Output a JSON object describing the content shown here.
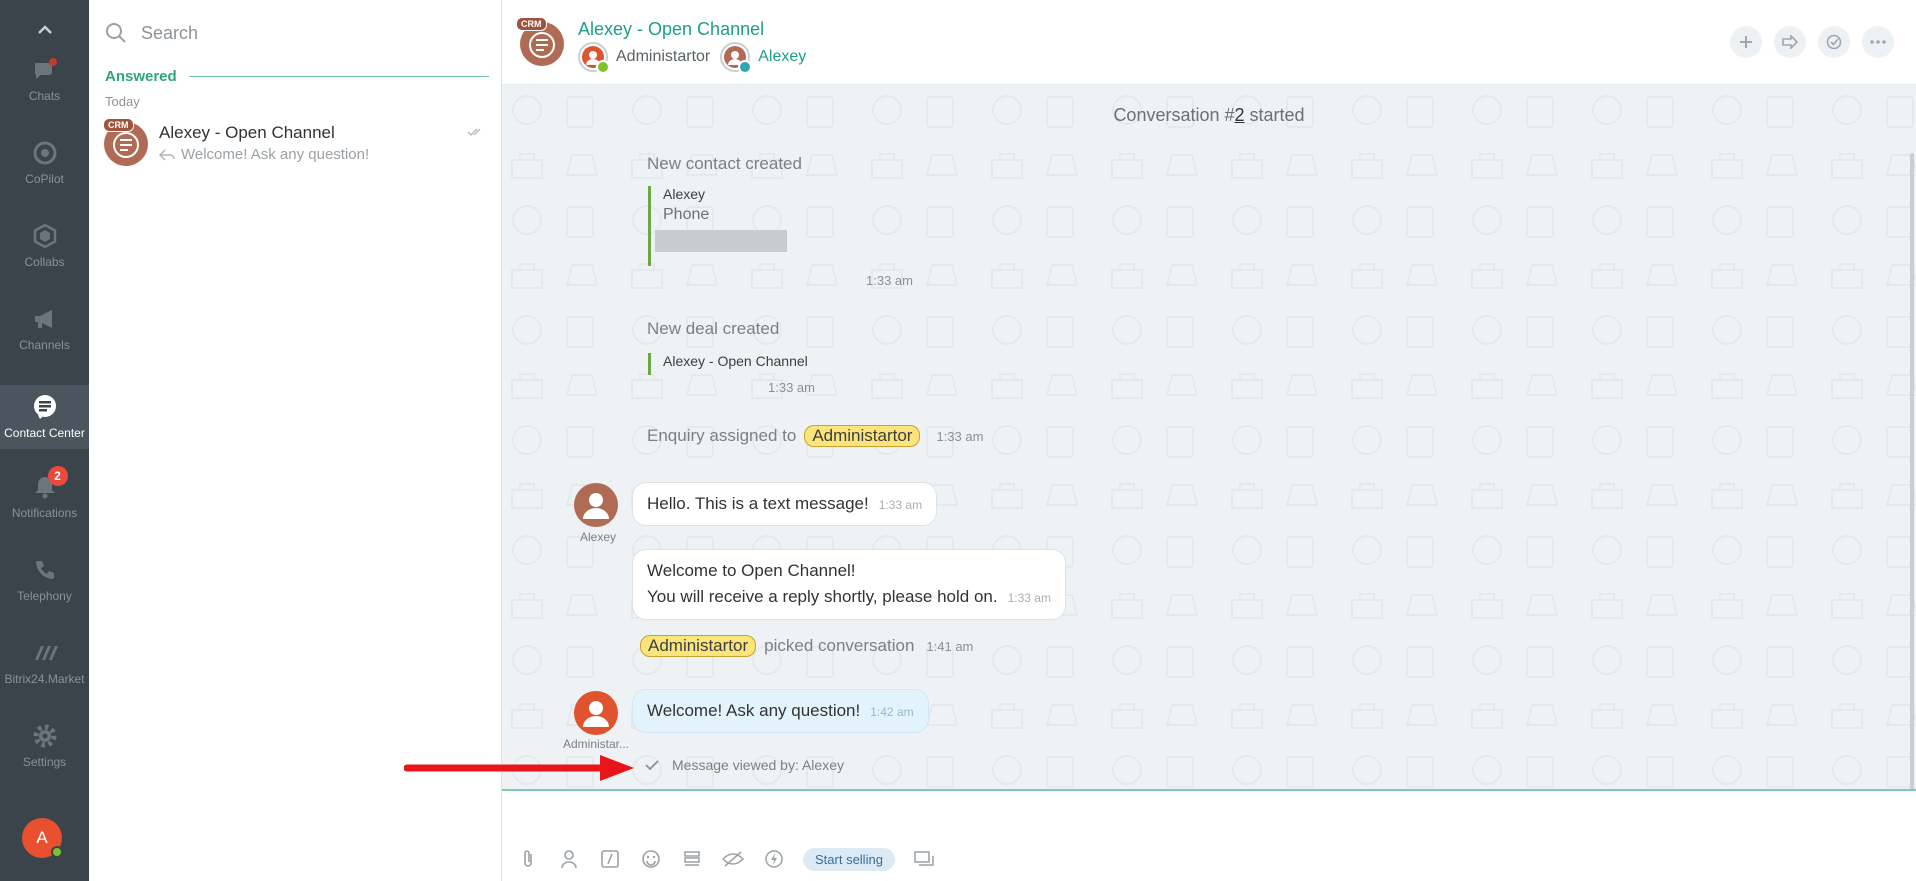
{
  "sidebar": {
    "items": [
      {
        "label": "Chats",
        "icon": "chat-bubbles-icon"
      },
      {
        "label": "CoPilot",
        "icon": "copilot-icon"
      },
      {
        "label": "Collabs",
        "icon": "hexagon-icon"
      },
      {
        "label": "Channels",
        "icon": "megaphone-icon"
      },
      {
        "label": "Contact Center",
        "icon": "contact-center-icon"
      },
      {
        "label": "Notifications",
        "icon": "bell-icon",
        "badge": "2"
      },
      {
        "label": "Telephony",
        "icon": "phone-icon"
      },
      {
        "label": "Bitrix24.Market",
        "icon": "market-icon"
      },
      {
        "label": "Settings",
        "icon": "gear-icon"
      }
    ],
    "user_initial": "A"
  },
  "list": {
    "search_placeholder": "Search",
    "group_label": "Answered",
    "date_label": "Today",
    "chat": {
      "badge": "CRM",
      "title": "Alexey - Open Channel",
      "preview": "Welcome! Ask any question!"
    }
  },
  "header": {
    "badge": "CRM",
    "title": "Alexey - Open Channel",
    "member1": "Administartor",
    "member2": "Alexey"
  },
  "messages": {
    "conv_start_prefix": "Conversation #",
    "conv_number": "2",
    "conv_start_suffix": " started",
    "contact_title": "New contact created",
    "contact_name": "Alexey",
    "contact_phone_label": "Phone",
    "contact_time": "1:33 am",
    "deal_title": "New deal created",
    "deal_name": "Alexey - Open Channel",
    "deal_time": "1:33 am",
    "assigned_prefix": "Enquiry assigned to",
    "assigned_to": "Administartor",
    "assigned_time": "1:33 am",
    "msg1_text": "Hello. This is a text message!",
    "msg1_time": "1:33 am",
    "msg1_author": "Alexey",
    "msg2_line1": "Welcome to Open Channel!",
    "msg2_line2": "You will receive a reply shortly, please hold on.",
    "msg2_time": "1:33 am",
    "picked_by": "Administartor",
    "picked_text": "picked conversation",
    "picked_time": "1:41 am",
    "msg3_text": "Welcome! Ask any question!",
    "msg3_time": "1:42 am",
    "msg3_author": "Administar...",
    "viewed_text": "Message viewed by: Alexey"
  },
  "composer": {
    "start_selling": "Start selling"
  },
  "colors": {
    "sidebar_bg": "#3b434b",
    "accent_green": "#1c9f84",
    "chat_bg": "#eef2f4",
    "chip_yellow": "#fbe47a",
    "arrow_red": "#e8141a"
  }
}
